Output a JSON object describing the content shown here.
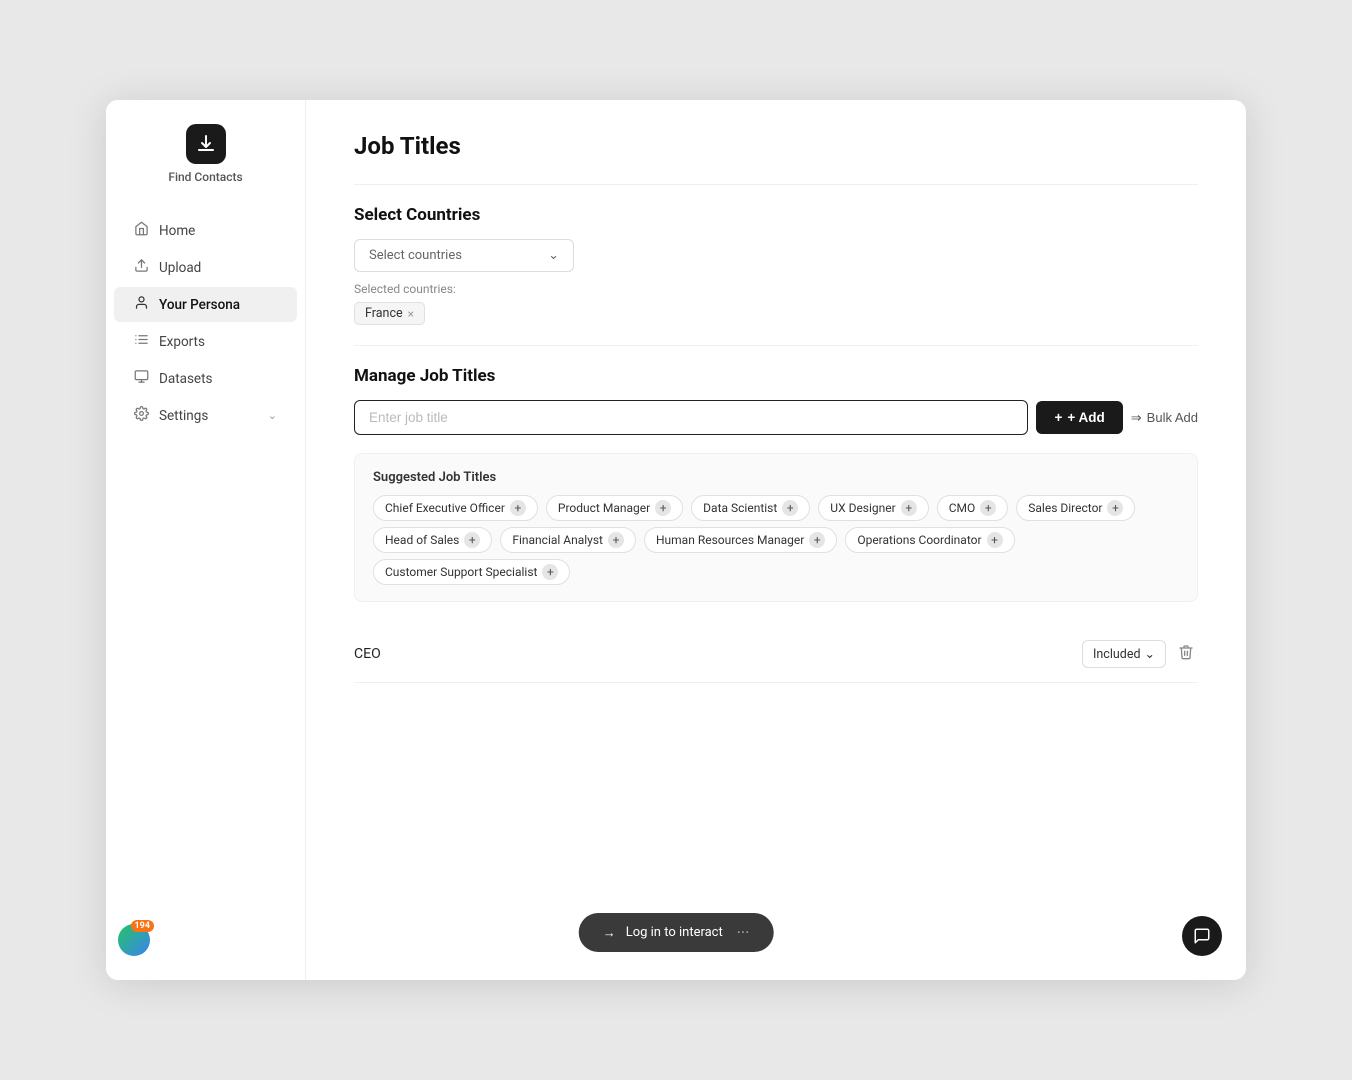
{
  "app": {
    "logo_label": "Find Contacts"
  },
  "sidebar": {
    "items": [
      {
        "id": "home",
        "label": "Home",
        "icon": "🏠",
        "active": false
      },
      {
        "id": "upload",
        "label": "Upload",
        "icon": "⬆",
        "active": false
      },
      {
        "id": "your-persona",
        "label": "Your Persona",
        "icon": "👤",
        "active": true
      },
      {
        "id": "exports",
        "label": "Exports",
        "icon": "☰",
        "active": false
      },
      {
        "id": "datasets",
        "label": "Datasets",
        "icon": "🗂",
        "active": false
      },
      {
        "id": "settings",
        "label": "Settings",
        "icon": "⚙",
        "active": false,
        "has_chevron": true
      }
    ],
    "avatar_badge": "194"
  },
  "page": {
    "title": "Job Titles",
    "select_countries": {
      "section_title": "Select Countries",
      "placeholder": "Select countries",
      "selected_label": "Selected countries:",
      "selected": [
        "France"
      ]
    },
    "manage_job_titles": {
      "section_title": "Manage Job Titles",
      "input_placeholder": "Enter job title",
      "add_button": "+ Add",
      "bulk_add_button": "Bulk Add",
      "suggested_title": "Suggested Job Titles",
      "chips": [
        "Chief Executive Officer",
        "Product Manager",
        "Data Scientist",
        "UX Designer",
        "CMO",
        "Sales Director",
        "Head of Sales",
        "Financial Analyst",
        "Human Resources Manager",
        "Operations Coordinator",
        "Customer Support Specialist"
      ],
      "entries": [
        {
          "name": "CEO",
          "status": "Included"
        }
      ]
    }
  },
  "login_bar": {
    "label": "Log in to interact"
  },
  "icons": {
    "chevron_down": "⌄",
    "plus": "+",
    "bulk": "⇒",
    "trash": "🗑",
    "chat": "💬",
    "logo": "⬇"
  }
}
